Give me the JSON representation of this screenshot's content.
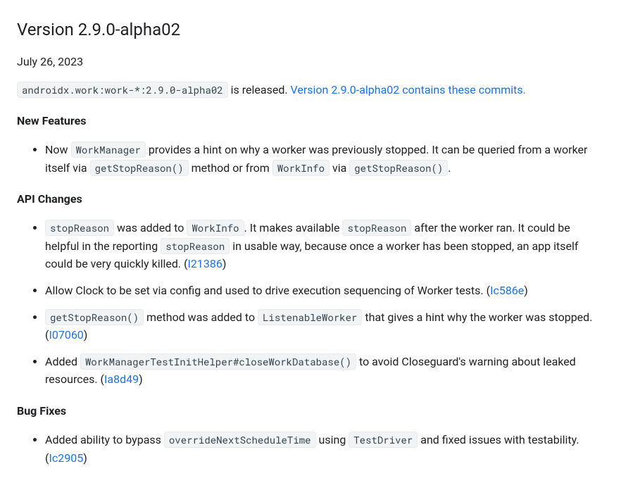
{
  "title": "Version 2.9.0-alpha02",
  "date": "July 26, 2023",
  "intro": {
    "artifact": "androidx.work:work-*:2.9.0-alpha02",
    "released_text": " is released. ",
    "commits_link": "Version 2.9.0-alpha02 contains these commits."
  },
  "sections": {
    "new_features": {
      "heading": "New Features",
      "items": [
        {
          "pre": "Now ",
          "code1": "WorkManager",
          "mid1": " provides a hint on why a worker was previously stopped. It can be queried from a worker itself via ",
          "code2": "getStopReason()",
          "mid2": " method or from ",
          "code3": "WorkInfo",
          "mid3": " via ",
          "code4": "getStopReason()",
          "post": "."
        }
      ]
    },
    "api_changes": {
      "heading": "API Changes",
      "items": [
        {
          "code1": "stopReason",
          "mid1": " was added to ",
          "code2": "WorkInfo",
          "mid2": ". It makes available ",
          "code3": "stopReason",
          "mid3": " after the worker ran. It could be helpful in the reporting ",
          "code4": "stopReason",
          "mid4": " in usable way, because once a worker has been stopped, an app itself could be very quickly killed. (",
          "link": "I21386",
          "post": ")"
        },
        {
          "text1": "Allow Clock to be set via config and used to drive execution sequencing of Worker tests. (",
          "link": "Ic586e",
          "post": ")"
        },
        {
          "code1": "getStopReason()",
          "mid1": " method was added to ",
          "code2": "ListenableWorker",
          "mid2": " that gives a hint why the worker was stopped. (",
          "link": "I07060",
          "post": ")"
        },
        {
          "pre": "Added ",
          "code1": "WorkManagerTestInitHelper#closeWorkDatabase()",
          "mid1": " to avoid Closeguard's warning about leaked resources. (",
          "link": "Ia8d49",
          "post": ")"
        }
      ]
    },
    "bug_fixes": {
      "heading": "Bug Fixes",
      "items": [
        {
          "pre": "Added ability to bypass ",
          "code1": "overrideNextScheduleTime",
          "mid1": " using ",
          "code2": "TestDriver",
          "mid2": " and fixed issues with testability. (",
          "link": "Ic2905",
          "post": ")"
        }
      ]
    }
  }
}
